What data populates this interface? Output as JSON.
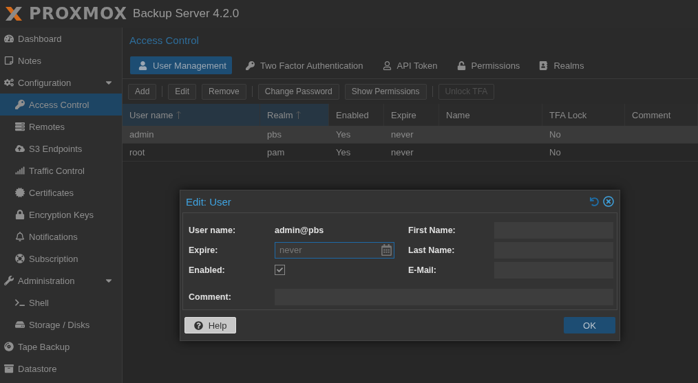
{
  "header": {
    "logo": "PROXMOX",
    "product": "Backup Server 4.2.0"
  },
  "sidebar": {
    "items": [
      {
        "label": "Dashboard",
        "selected": false
      },
      {
        "label": "Notes",
        "selected": false
      },
      {
        "label": "Configuration",
        "selected": false,
        "expanded": true,
        "children": [
          {
            "label": "Access Control",
            "selected": true
          },
          {
            "label": "Remotes",
            "selected": false
          },
          {
            "label": "S3 Endpoints",
            "selected": false
          },
          {
            "label": "Traffic Control",
            "selected": false
          },
          {
            "label": "Certificates",
            "selected": false
          },
          {
            "label": "Encryption Keys",
            "selected": false
          },
          {
            "label": "Notifications",
            "selected": false
          },
          {
            "label": "Subscription",
            "selected": false
          }
        ]
      },
      {
        "label": "Administration",
        "selected": false,
        "expanded": true,
        "children": [
          {
            "label": "Shell",
            "selected": false
          },
          {
            "label": "Storage / Disks",
            "selected": false
          }
        ]
      },
      {
        "label": "Tape Backup",
        "selected": false
      },
      {
        "label": "Datastore",
        "selected": false
      }
    ]
  },
  "panel": {
    "title": "Access Control",
    "tabs": [
      {
        "label": "User Management",
        "selected": true
      },
      {
        "label": "Two Factor Authentication",
        "selected": false
      },
      {
        "label": "API Token",
        "selected": false
      },
      {
        "label": "Permissions",
        "selected": false
      },
      {
        "label": "Realms",
        "selected": false
      }
    ],
    "toolbar": [
      {
        "label": "Add",
        "disabled": false
      },
      {
        "kind": "separator"
      },
      {
        "label": "Edit",
        "disabled": false
      },
      {
        "label": "Remove",
        "disabled": false
      },
      {
        "kind": "separator"
      },
      {
        "label": "Change Password",
        "disabled": false
      },
      {
        "label": "Show Permissions",
        "disabled": false
      },
      {
        "kind": "separator"
      },
      {
        "label": "Unlock TFA",
        "disabled": true
      }
    ],
    "table": {
      "columns": [
        {
          "label": "User name",
          "sorted": true
        },
        {
          "label": "Realm",
          "sorted": true
        },
        {
          "label": "Enabled",
          "sorted": false
        },
        {
          "label": "Expire",
          "sorted": false
        },
        {
          "label": "Name",
          "sorted": false
        },
        {
          "label": "TFA Lock",
          "sorted": false
        },
        {
          "label": "Comment",
          "sorted": false
        }
      ],
      "rows": [
        {
          "selected": true,
          "cells": [
            "admin",
            "pbs",
            "Yes",
            "never",
            "",
            "No",
            ""
          ]
        },
        {
          "selected": false,
          "cells": [
            "root",
            "pam",
            "Yes",
            "never",
            "",
            "No",
            ""
          ]
        }
      ]
    }
  },
  "dialog": {
    "title": "Edit: User",
    "user_name": {
      "label": "User name:",
      "value": "admin@pbs"
    },
    "expire": {
      "label": "Expire:",
      "placeholder": "never"
    },
    "enabled": {
      "label": "Enabled:",
      "checked": true
    },
    "first_name": {
      "label": "First Name:"
    },
    "last_name": {
      "label": "Last Name:"
    },
    "email": {
      "label": "E-Mail:"
    },
    "comment": {
      "label": "Comment:"
    },
    "help_button": "Help",
    "ok_button": "OK"
  }
}
